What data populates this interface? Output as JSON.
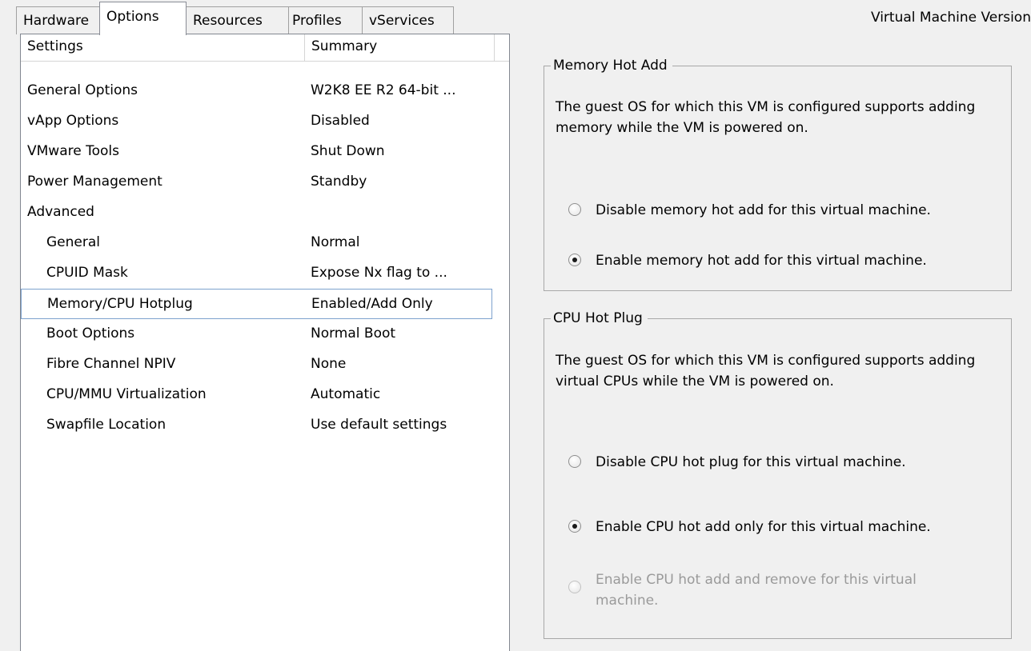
{
  "tabs": [
    {
      "label": "Hardware"
    },
    {
      "label": "Options"
    },
    {
      "label": "Resources"
    },
    {
      "label": "Profiles"
    },
    {
      "label": "vServices"
    }
  ],
  "vm_version": "Virtual Machine Version",
  "list": {
    "columns": [
      "Settings",
      "Summary"
    ],
    "rows": [
      {
        "setting": "General Options",
        "summary": "W2K8 EE R2 64-bit ..."
      },
      {
        "setting": "vApp Options",
        "summary": "Disabled"
      },
      {
        "setting": "VMware Tools",
        "summary": "Shut Down"
      },
      {
        "setting": "Power Management",
        "summary": "Standby"
      },
      {
        "setting": "Advanced",
        "summary": ""
      },
      {
        "setting": "General",
        "summary": "Normal"
      },
      {
        "setting": "CPUID Mask",
        "summary": "Expose Nx flag to ..."
      },
      {
        "setting": "Memory/CPU Hotplug",
        "summary": "Enabled/Add Only"
      },
      {
        "setting": "Boot Options",
        "summary": "Normal Boot"
      },
      {
        "setting": "Fibre Channel NPIV",
        "summary": "None"
      },
      {
        "setting": "CPU/MMU Virtualization",
        "summary": "Automatic"
      },
      {
        "setting": "Swapfile Location",
        "summary": "Use default settings"
      }
    ]
  },
  "memory_hot_add": {
    "title": "Memory Hot Add",
    "description": "The guest OS for which this VM is configured supports adding memory while the VM is powered on.",
    "options": [
      {
        "label": "Disable memory hot add for this virtual machine.",
        "checked": false
      },
      {
        "label": "Enable memory hot add for this virtual machine.",
        "checked": true
      }
    ]
  },
  "cpu_hot_plug": {
    "title": "CPU Hot Plug",
    "description": "The guest OS for which this VM is configured supports adding virtual CPUs while the VM is powered on.",
    "options": [
      {
        "label": "Disable CPU hot plug for this virtual machine.",
        "checked": false
      },
      {
        "label": "Enable CPU hot add only for this virtual machine.",
        "checked": true
      },
      {
        "label": "Enable CPU hot add and remove for this virtual machine.",
        "checked": false,
        "disabled": true
      }
    ]
  }
}
